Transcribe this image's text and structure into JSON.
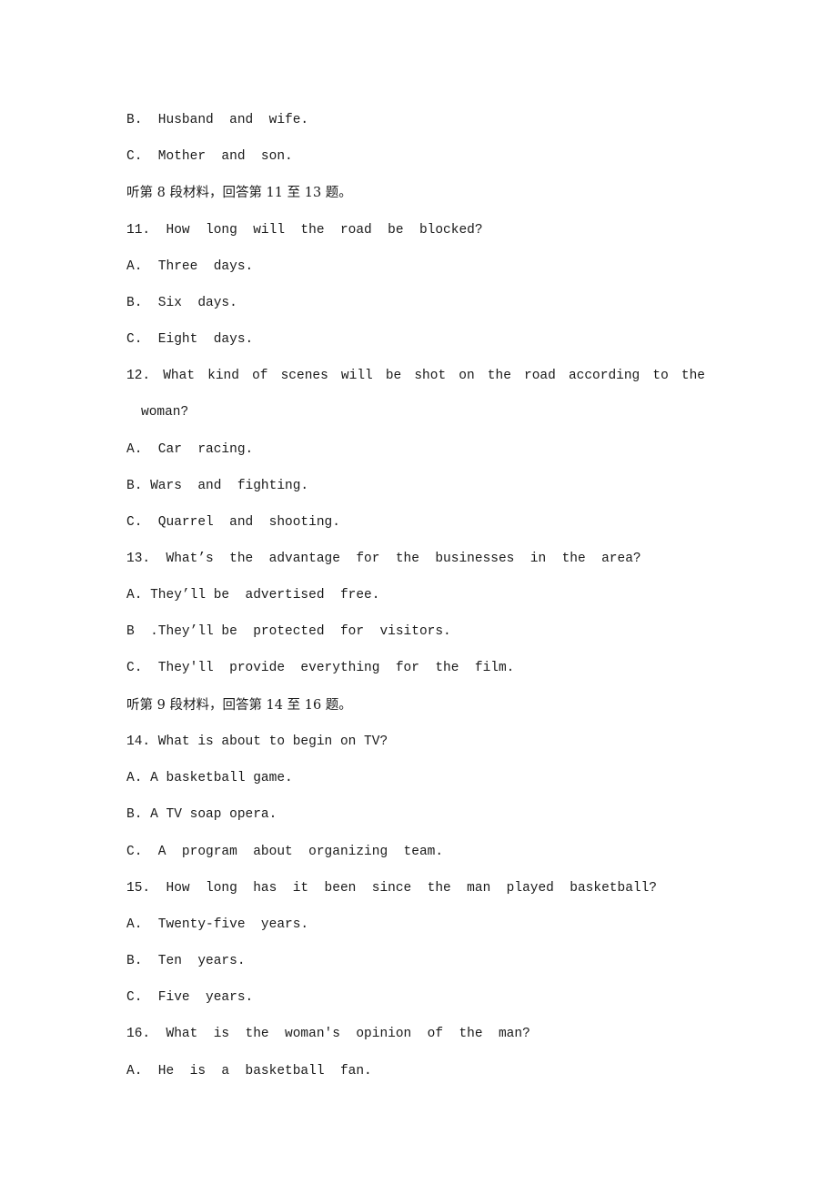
{
  "document": {
    "lines": [
      {
        "kind": "option",
        "text": "B.  Husband  and  wife."
      },
      {
        "kind": "option",
        "text": "C.  Mother  and  son."
      },
      {
        "kind": "section-instruction",
        "text": "听第 8 段材料，回答第 11 至 13 题。"
      },
      {
        "kind": "question",
        "number": "11",
        "text": "11.  How  long  will  the  road  be  blocked?"
      },
      {
        "kind": "option",
        "text": "A.  Three  days."
      },
      {
        "kind": "option",
        "text": "B.  Six  days."
      },
      {
        "kind": "option",
        "text": "C.  Eight  days."
      },
      {
        "kind": "question",
        "number": "12",
        "text": "12.  What  kind  of  scenes  will  be  shot  on  the  road  according  to  the"
      },
      {
        "kind": "question-continuation",
        "text": "woman?"
      },
      {
        "kind": "option",
        "text": "A.  Car  racing."
      },
      {
        "kind": "option",
        "text": "B. Wars  and  fighting."
      },
      {
        "kind": "option",
        "text": "C.  Quarrel  and  shooting."
      },
      {
        "kind": "question",
        "number": "13",
        "text": "13.  What’s  the  advantage  for  the  businesses  in  the  area?"
      },
      {
        "kind": "option",
        "text": "A. They’ll be  advertised  free."
      },
      {
        "kind": "option",
        "text": "B  .They’ll be  protected  for  visitors."
      },
      {
        "kind": "option",
        "text": "C.  They'll  provide  everything  for  the  film."
      },
      {
        "kind": "section-instruction",
        "text": "听第 9 段材料，回答第 14 至 16 题。"
      },
      {
        "kind": "question",
        "number": "14",
        "text": "14. What is about to begin on TV?"
      },
      {
        "kind": "option",
        "text": "A. A basketball game."
      },
      {
        "kind": "option",
        "text": "B. A TV soap opera."
      },
      {
        "kind": "option",
        "text": "C.  A  program  about  organizing  team."
      },
      {
        "kind": "question",
        "number": "15",
        "text": "15.  How  long  has  it  been  since  the  man  played  basketball?"
      },
      {
        "kind": "option",
        "text": "A.  Twenty-five  years."
      },
      {
        "kind": "option",
        "text": "B.  Ten  years."
      },
      {
        "kind": "option",
        "text": "C.  Five  years."
      },
      {
        "kind": "question",
        "number": "16",
        "text": "16.  What  is  the  woman's  opinion  of  the  man?"
      },
      {
        "kind": "option",
        "text": "A.  He  is  a  basketball  fan."
      }
    ]
  }
}
